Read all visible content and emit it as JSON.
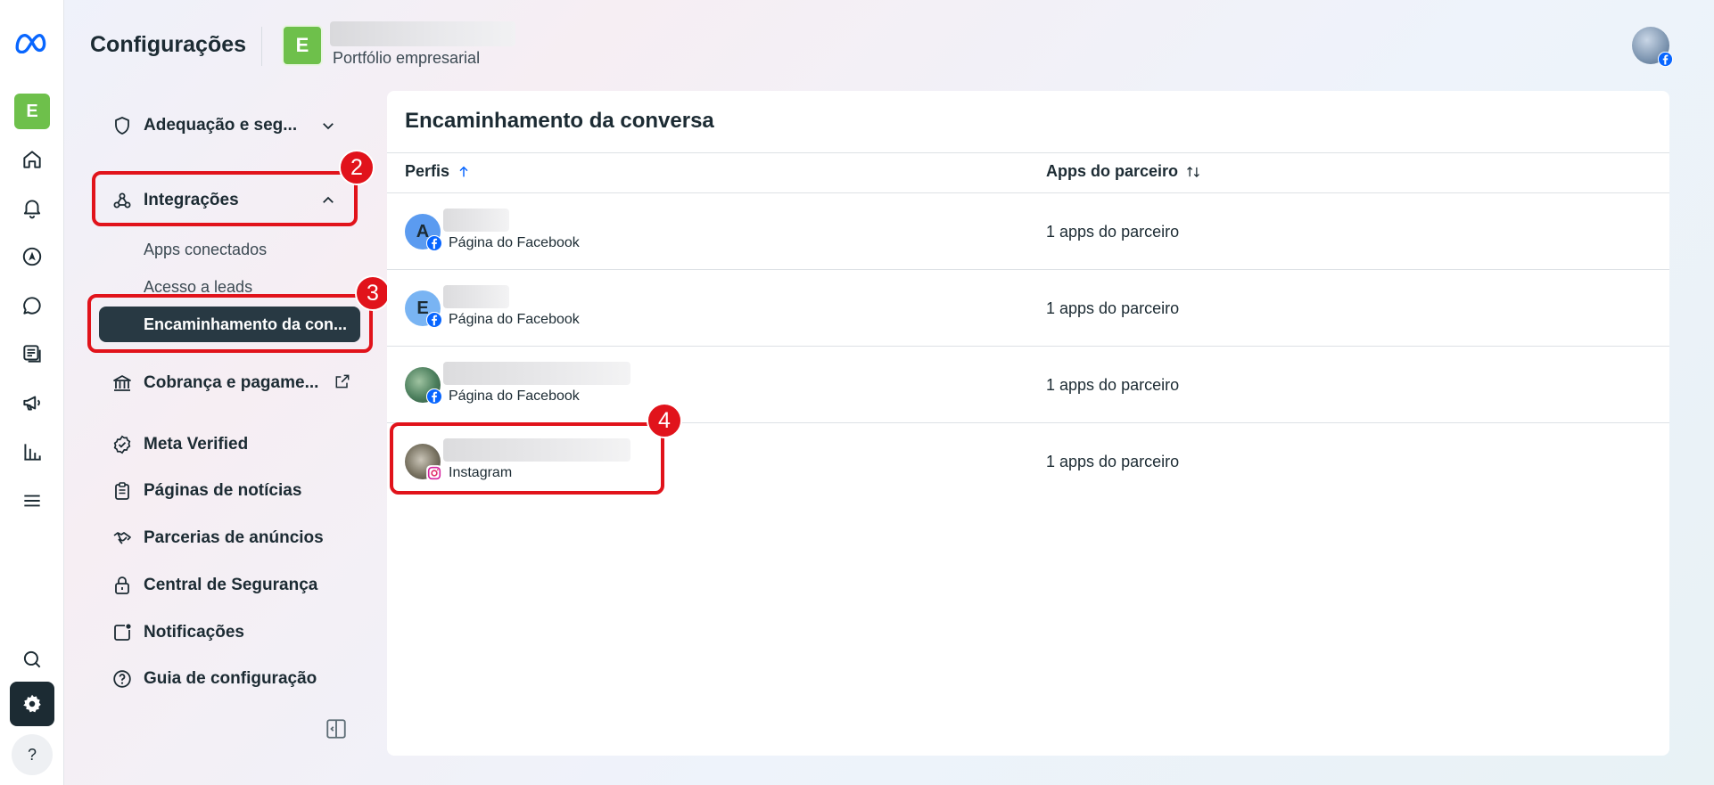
{
  "header": {
    "title": "Configurações",
    "badge_letter": "E",
    "subtitle": "Portfólio empresarial"
  },
  "rail": {
    "avatar_letter": "E",
    "help_label": "?"
  },
  "menu": {
    "compliance": "Adequação e seg...",
    "integrations": "Integrações",
    "sub_connected_apps": "Apps conectados",
    "sub_leads_access": "Acesso a leads",
    "sub_conversation_routing": "Encaminhamento da con...",
    "billing": "Cobrança e pagame...",
    "meta_verified": "Meta Verified",
    "news_pages": "Páginas de notícias",
    "ad_partnerships": "Parcerias de anúncios",
    "security_center": "Central de Segurança",
    "notifications": "Notificações",
    "setup_guide": "Guia de configuração"
  },
  "steps": {
    "s2": "2",
    "s3": "3",
    "s4": "4"
  },
  "panel": {
    "title": "Encaminhamento da conversa",
    "col_profiles": "Perfis",
    "col_partner_apps": "Apps do parceiro",
    "rows": [
      {
        "avatar_letter": "A",
        "type": "Página do Facebook",
        "apps": "1 apps do parceiro"
      },
      {
        "avatar_letter": "E",
        "type": "Página do Facebook",
        "apps": "1 apps do parceiro"
      },
      {
        "avatar_letter": "",
        "type": "Página do Facebook",
        "apps": "1 apps do parceiro"
      },
      {
        "avatar_letter": "",
        "type": "Instagram",
        "apps": "1 apps do parceiro"
      }
    ]
  },
  "colors": {
    "accent_red": "#e1131b",
    "active_bg": "#283943",
    "brand_blue": "#0866ff",
    "badge_green": "#6ec04b"
  }
}
